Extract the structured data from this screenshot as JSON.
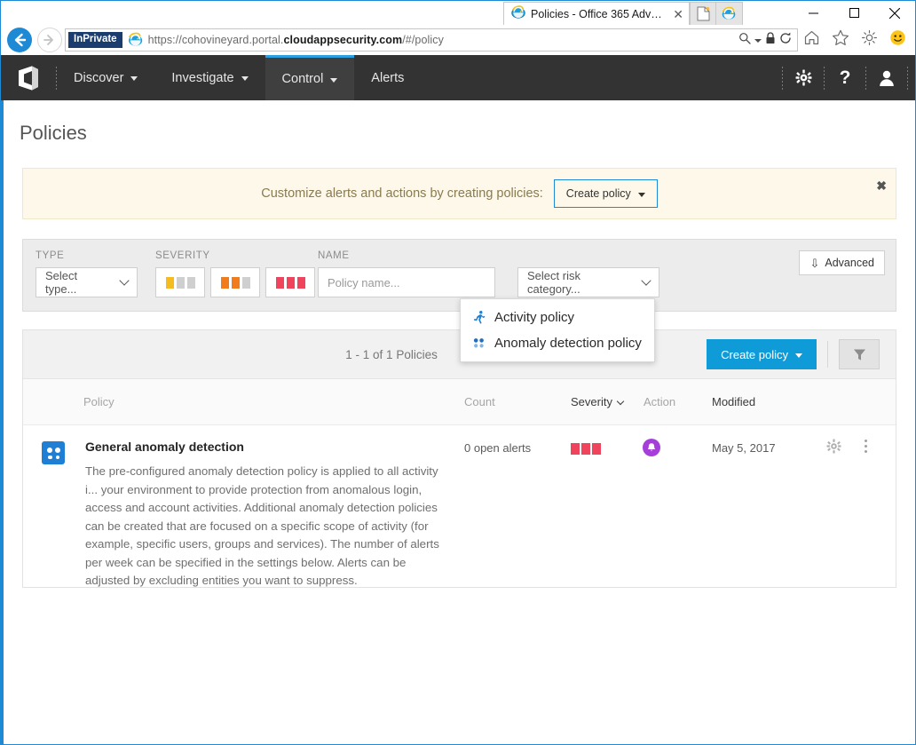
{
  "browser": {
    "inprivate_badge": "InPrivate",
    "url_prefix": "https://cohovineyard.portal.",
    "url_bold": "cloudappsecurity.com",
    "url_suffix": "/#/policy",
    "tab_title": "Policies - Office 365 Advan...",
    "icons": {
      "back": "back-arrow-icon",
      "forward": "forward-arrow-icon",
      "ie_favicon": "internet-explorer-icon",
      "search": "search-icon",
      "lock": "lock-icon",
      "refresh": "refresh-icon",
      "home": "home-icon",
      "favorites": "star-icon",
      "tools": "gear-icon",
      "feedback": "smiley-icon",
      "minimize": "minimize-icon",
      "maximize": "maximize-icon",
      "close": "close-icon"
    }
  },
  "appnav": {
    "logo": "office-logo",
    "items": [
      {
        "label": "Discover",
        "has_caret": true,
        "active": false
      },
      {
        "label": "Investigate",
        "has_caret": true,
        "active": false
      },
      {
        "label": "Control",
        "has_caret": true,
        "active": true
      },
      {
        "label": "Alerts",
        "has_caret": false,
        "active": false
      }
    ],
    "right_icons": [
      "settings-gear-icon",
      "help-question-icon",
      "user-account-icon"
    ]
  },
  "page": {
    "title": "Policies"
  },
  "banner": {
    "text": "Customize alerts and actions by creating policies:",
    "button_label": "Create policy",
    "close_label": "✖"
  },
  "create_menu": {
    "items": [
      {
        "label": "Activity policy",
        "icon": "running-person-icon"
      },
      {
        "label": "Anomaly detection policy",
        "icon": "four-dots-icon"
      }
    ]
  },
  "filters": {
    "type": {
      "label": "TYPE",
      "value": "Select type..."
    },
    "severity": {
      "label": "SEVERITY",
      "options": [
        {
          "name": "low",
          "filled": 1,
          "color": "#f5bc20"
        },
        {
          "name": "medium",
          "filled": 2,
          "color": "#f07c1c"
        },
        {
          "name": "high",
          "filled": 3,
          "color": "#f0445c"
        }
      ],
      "empty_color": "#cfcfcf"
    },
    "name": {
      "label": "NAME",
      "placeholder": "Policy name..."
    },
    "risk_category": {
      "value": "Select risk category..."
    },
    "advanced_label": "Advanced"
  },
  "results": {
    "count_text": "1 - 1 of 1 Policies",
    "create_button": "Create policy",
    "filter_icon": "funnel-filter-icon",
    "columns": [
      {
        "key": "policy",
        "label": "Policy",
        "strong": false,
        "sortable": true
      },
      {
        "key": "count",
        "label": "Count",
        "strong": false,
        "sortable": true
      },
      {
        "key": "severity",
        "label": "Severity",
        "strong": true,
        "sortable": true
      },
      {
        "key": "action",
        "label": "Action",
        "strong": false,
        "sortable": true
      },
      {
        "key": "modified",
        "label": "Modified",
        "strong": true,
        "sortable": true
      }
    ],
    "rows": [
      {
        "icon": "four-dots-icon",
        "name": "General anomaly detection",
        "description": "The pre-configured anomaly detection policy is applied to all activity i... your environment to provide protection from anomalous login, access and account activities. Additional anomaly detection policies can be created that are focused on a specific scope of activity (for example, specific users, groups and services). The number of alerts per week can be specified in the settings below. Alerts can be adjusted by excluding entities you want to suppress.",
        "count": "0 open alerts",
        "severity": "high",
        "severity_bars": 3,
        "action_icon": "alert-bell-icon",
        "modified": "May 5, 2017",
        "settings_icon": "gear-icon",
        "more_icon": "kebab-menu-icon"
      }
    ]
  },
  "colors": {
    "accent_blue": "#1e8ad6",
    "primary_button": "#0f9bd7",
    "nav_background": "#333333",
    "banner_background": "#fdf8e9",
    "severity_high": "#f0445c",
    "severity_medium": "#f07c1c",
    "severity_low": "#f5bc20",
    "action_purple": "#a63fd9",
    "policy_icon_blue": "#1e7fd4"
  }
}
